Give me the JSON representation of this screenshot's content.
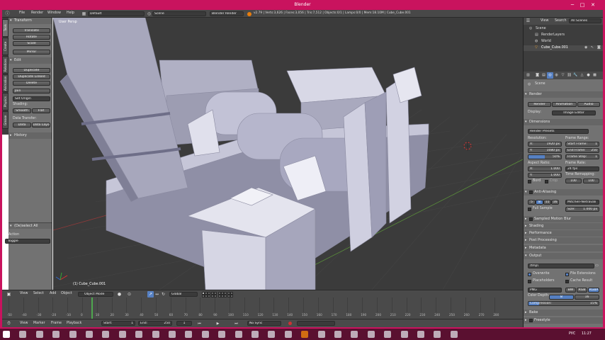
{
  "window": {
    "title": "Blender"
  },
  "menubar": {
    "menus": [
      "File",
      "Render",
      "Window",
      "Help"
    ],
    "screen_layout": "Default",
    "scene": "Scene",
    "engine": "Blender Render",
    "stats": "v2.79 | Verts:3,626 | Faces:3,056 | Tris:7,512 | Objects:0/1 | Lamps:0/0 | Mem:18.10M | Cube_Cube.001"
  },
  "side_tabs": [
    "Tools",
    "Create",
    "Relations",
    "Animation",
    "Physics",
    "Grease Pencil"
  ],
  "toolshelf": {
    "transform_title": "Transform",
    "transform_buttons": [
      "Translate",
      "Rotate",
      "Scale",
      "Mirror"
    ],
    "edit_title": "Edit",
    "edit_buttons": [
      "Duplicate",
      "Duplicate Linked",
      "Delete"
    ],
    "join": "Join",
    "set_origin": "Set Origin",
    "shading_label": "Shading:",
    "smooth": "Smooth",
    "flat": "Flat",
    "data_transfer_label": "Data Transfer:",
    "data": "Data",
    "data_layout": "Data Layo",
    "history_title": "History"
  },
  "operator_panel": {
    "title": "(De)select All",
    "action_label": "Action",
    "action_value": "Toggle"
  },
  "viewport": {
    "view_label": "User Persp",
    "object_label": "(1) Cube_Cube.001"
  },
  "viewport_header": {
    "menus": [
      "View",
      "Select",
      "Add",
      "Object"
    ],
    "mode": "Object Mode",
    "pivot": "Global"
  },
  "outliner": {
    "menus": [
      "View",
      "Search"
    ],
    "display_mode": "All Scenes",
    "items": [
      "Scene",
      "RenderLayers",
      "World",
      "Cube_Cube.001"
    ]
  },
  "properties": {
    "context": "Scene",
    "render_title": "Render",
    "render_buttons": [
      "Render",
      "Animation",
      "Audio"
    ],
    "display_label": "Display:",
    "display_value": "Image Editor",
    "dimensions_title": "Dimensions",
    "presets": "Render Presets",
    "resolution_label": "Resolution:",
    "res_x": "X:",
    "res_x_value": "1920 px",
    "res_y": "Y:",
    "res_y_value": "1080 px",
    "res_pct": "50%",
    "frame_range_label": "Frame Range:",
    "start_frame": "Start Frame:",
    "start_frame_value": "1",
    "end_frame": "End Frame:",
    "end_frame_value": "250",
    "frame_step": "Frame Step:",
    "frame_step_value": "1",
    "aspect_label": "Aspect Ratio:",
    "asp_x": "X:",
    "asp_x_value": "1.000",
    "asp_y": "Y:",
    "asp_y_value": "1.000",
    "frame_rate_label": "Frame Rate:",
    "frame_rate": "24 fps",
    "time_remap": "Time Remapping:",
    "remap_old": "100",
    "remap_new": "100",
    "border": "Bord",
    "crop": "Crop",
    "aa_title": "Anti-Aliasing",
    "aa_samples": [
      "5",
      "8",
      "11",
      "16"
    ],
    "aa_filter": "Mitchell-Netravali",
    "full_sample": "Full Sample",
    "aa_size_label": "Size:",
    "aa_size": "1.000 px",
    "collapsed_panels": [
      "Sampled Motion Blur",
      "Shading",
      "Performance",
      "Post Processing",
      "Metadata"
    ],
    "output_title": "Output",
    "output_path": "/tmp\\",
    "overwrite": "Overwrite",
    "file_extensions": "File Extensions",
    "placeholders": "Placeholders",
    "cache_result": "Cache Result",
    "format": "PNG",
    "color_modes": [
      "BW",
      "RGB",
      "RGBA"
    ],
    "color_depth_label": "Color Depth:",
    "color_depth": [
      "8",
      "16"
    ],
    "compression_label": "Compression:",
    "compression": "15%",
    "bake_title": "Bake",
    "freestyle_title": "Freestyle"
  },
  "timeline": {
    "ruler": [
      "-50",
      "-40",
      "-30",
      "-20",
      "-10",
      "0",
      "10",
      "20",
      "30",
      "40",
      "50",
      "60",
      "70",
      "80",
      "90",
      "100",
      "110",
      "120",
      "130",
      "140",
      "150",
      "160",
      "170",
      "180",
      "190",
      "200",
      "210",
      "220",
      "230",
      "240",
      "250",
      "260",
      "270",
      "280"
    ],
    "menus": [
      "View",
      "Marker",
      "Frame",
      "Playback"
    ],
    "start_label": "Start:",
    "start": "1",
    "end_label": "End:",
    "end": "250",
    "current": "1",
    "sync": "No Sync"
  },
  "taskbar": {
    "language": "РУС",
    "time": "11:27"
  },
  "colors": {
    "accent_pink": "#c9135e",
    "selection_blue": "#5680c2",
    "panel_bg": "#727272",
    "viewport_bg": "#3b3b3b",
    "header_bg": "#4a4a4a"
  }
}
